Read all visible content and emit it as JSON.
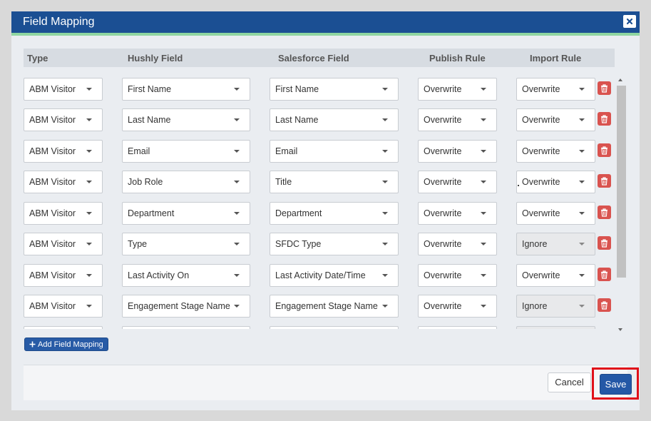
{
  "modal": {
    "title": "Field Mapping",
    "close_icon": "close-icon"
  },
  "columns": [
    "Type",
    "Hushly Field",
    "Salesforce Field",
    "Publish Rule",
    "Import Rule"
  ],
  "rows": [
    {
      "type": "ABM Visitor",
      "hushly": "First Name",
      "salesforce": "First Name",
      "publish": "Overwrite",
      "import": "Overwrite",
      "import_disabled": false
    },
    {
      "type": "ABM Visitor",
      "hushly": "Last Name",
      "salesforce": "Last Name",
      "publish": "Overwrite",
      "import": "Overwrite",
      "import_disabled": false
    },
    {
      "type": "ABM Visitor",
      "hushly": "Email",
      "salesforce": "Email",
      "publish": "Overwrite",
      "import": "Overwrite",
      "import_disabled": false
    },
    {
      "type": "ABM Visitor",
      "hushly": "Job Role",
      "salesforce": "Title",
      "publish": "Overwrite",
      "import": "Overwrite",
      "import_disabled": false
    },
    {
      "type": "ABM Visitor",
      "hushly": "Department",
      "salesforce": "Department",
      "publish": "Overwrite",
      "import": "Overwrite",
      "import_disabled": false
    },
    {
      "type": "ABM Visitor",
      "hushly": "Type",
      "salesforce": "SFDC Type",
      "publish": "Overwrite",
      "import": "Ignore",
      "import_disabled": true
    },
    {
      "type": "ABM Visitor",
      "hushly": "Last Activity On",
      "salesforce": "Last Activity Date/Time",
      "publish": "Overwrite",
      "import": "Overwrite",
      "import_disabled": false
    },
    {
      "type": "ABM Visitor",
      "hushly": "Engagement Stage Name",
      "salesforce": "Engagement Stage Name",
      "publish": "Overwrite",
      "import": "Ignore",
      "import_disabled": true
    },
    {
      "type": "",
      "hushly": "",
      "salesforce": "",
      "publish": "",
      "import": "",
      "import_disabled": true
    }
  ],
  "add_button": {
    "label": "Add Field Mapping",
    "icon": "plus-icon"
  },
  "footer": {
    "cancel_label": "Cancel",
    "save_label": "Save"
  },
  "colors": {
    "header_bg": "#1b4f93",
    "header_accent": "#8fd6a1",
    "primary": "#2458a6",
    "danger": "#d9534f",
    "highlight": "#e0101a"
  }
}
